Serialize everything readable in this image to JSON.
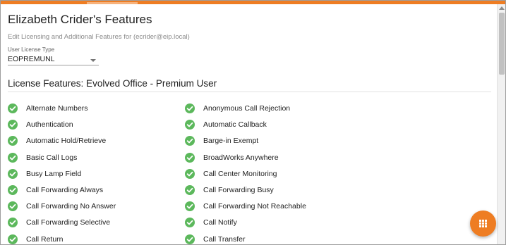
{
  "header": {
    "title": "Elizabeth Crider's Features",
    "subtitle": "Edit Licensing and Additional Features for (ecrider@eip.local)"
  },
  "license_select": {
    "label": "User License Type",
    "value": "EOPREMUNL"
  },
  "section": {
    "title": "License Features: Evolved Office - Premium User"
  },
  "features": {
    "left": [
      "Alternate Numbers",
      "Authentication",
      "Automatic Hold/Retrieve",
      "Basic Call Logs",
      "Busy Lamp Field",
      "Call Forwarding Always",
      "Call Forwarding No Answer",
      "Call Forwarding Selective",
      "Call Return"
    ],
    "right": [
      "Anonymous Call Rejection",
      "Automatic Callback",
      "Barge-in Exempt",
      "BroadWorks Anywhere",
      "Call Center Monitoring",
      "Call Forwarding Busy",
      "Call Forwarding Not Reachable",
      "Call Notify",
      "Call Transfer"
    ],
    "status_icon": "check-circle-icon"
  },
  "fab": {
    "icon": "apps-grid-icon"
  },
  "colors": {
    "accent": "#ee7d23",
    "check": "#5cb85c"
  }
}
